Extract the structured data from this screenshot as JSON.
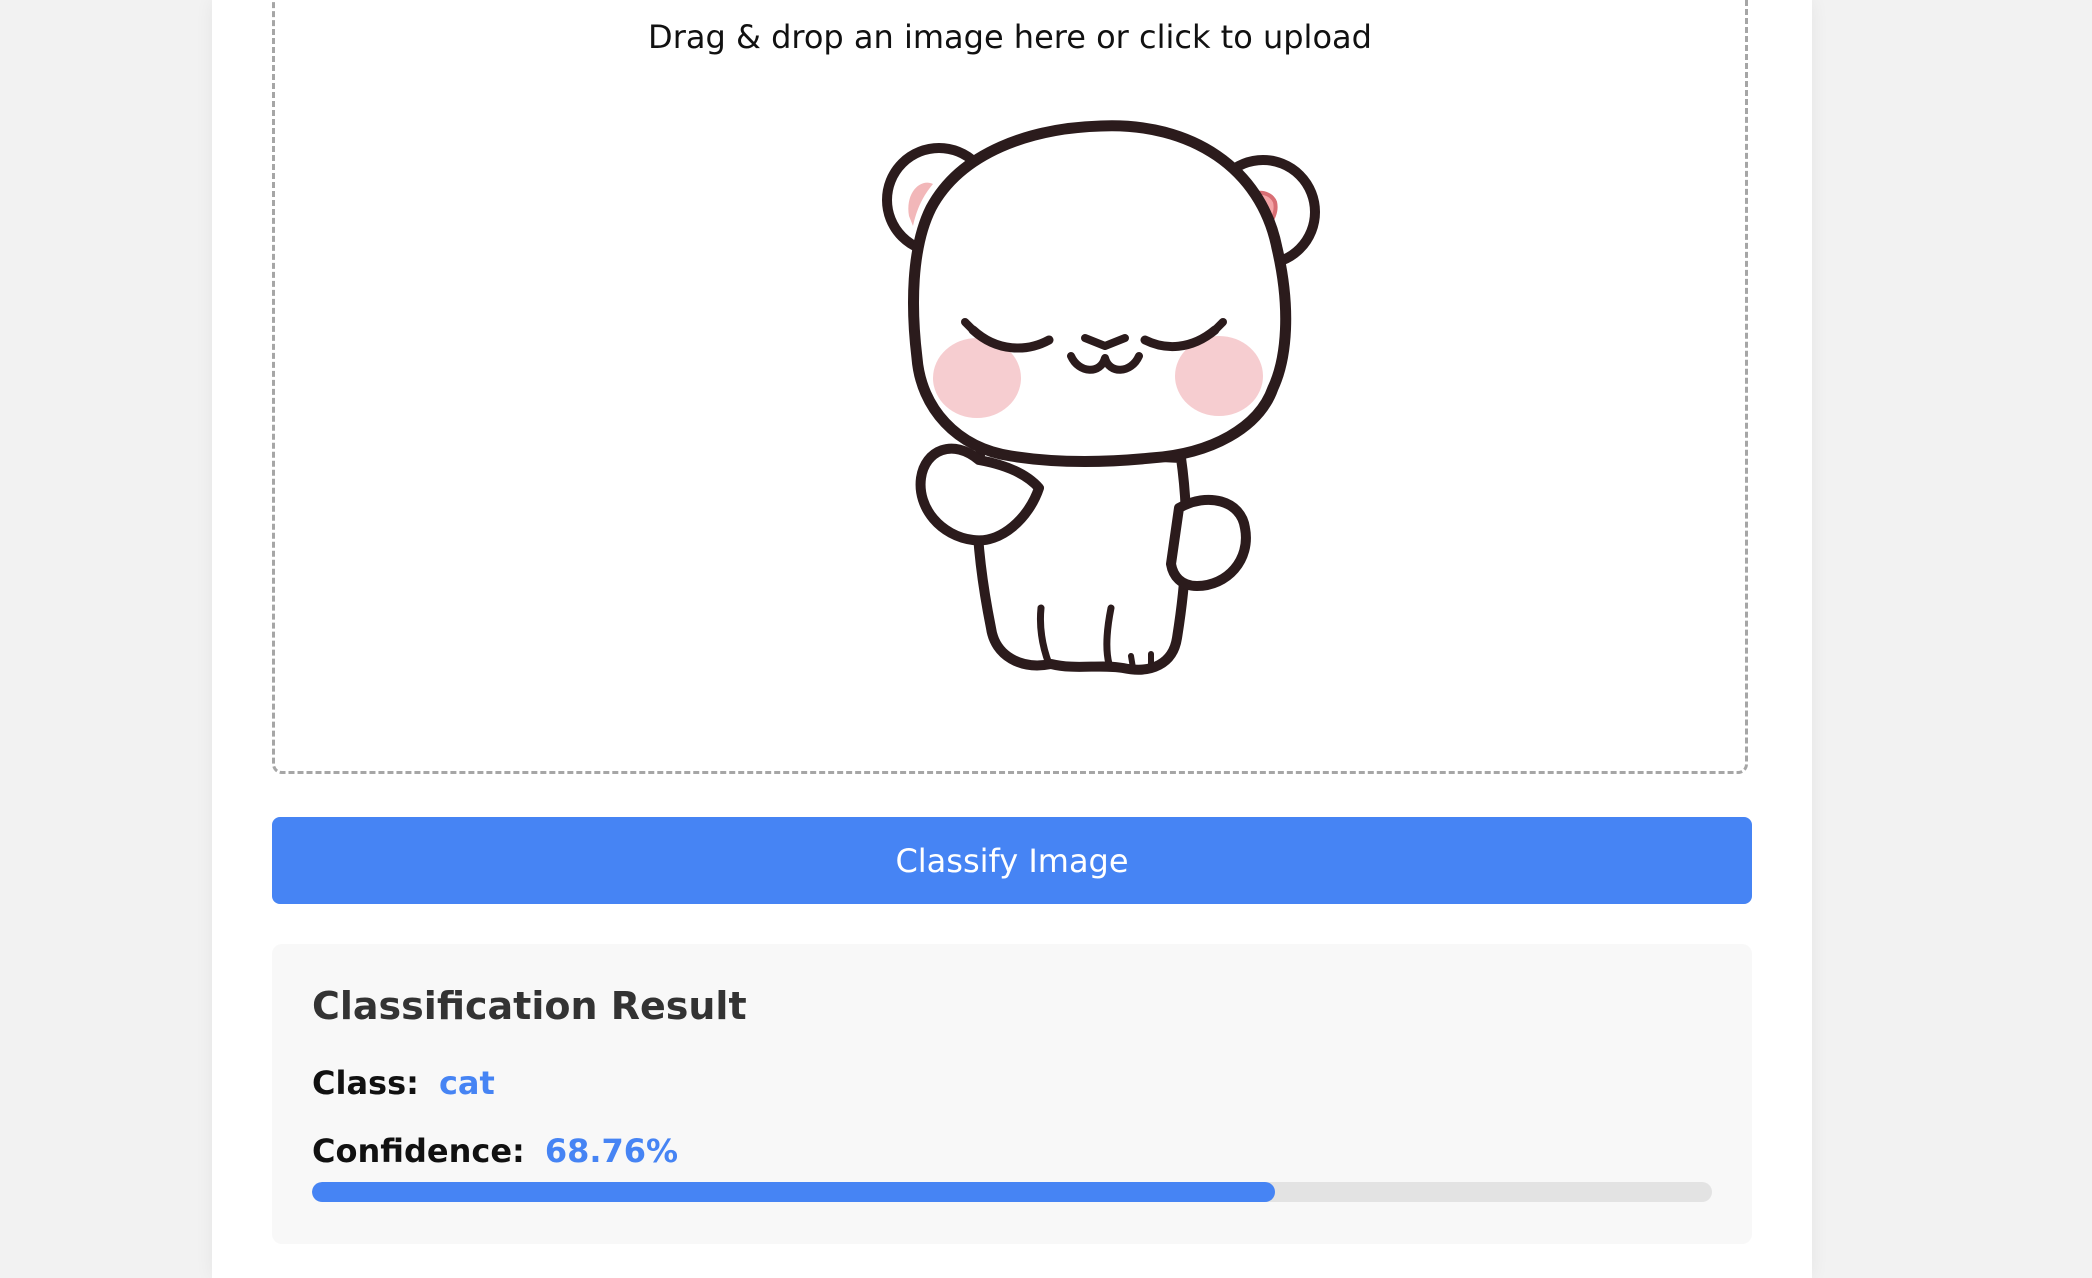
{
  "upload": {
    "prompt": "Drag & drop an image here or click to upload",
    "preview_image": "cartoon-bear-image"
  },
  "actions": {
    "classify_label": "Classify Image"
  },
  "result": {
    "title": "Classification Result",
    "class_label": "Class:",
    "class_value": "cat",
    "confidence_label": "Confidence:",
    "confidence_value": "68.76%",
    "confidence_fraction": 0.6876
  },
  "colors": {
    "accent": "#4684f4",
    "background": "#f2f2f2",
    "panel": "#f8f8f8",
    "track": "#e3e3e3"
  }
}
